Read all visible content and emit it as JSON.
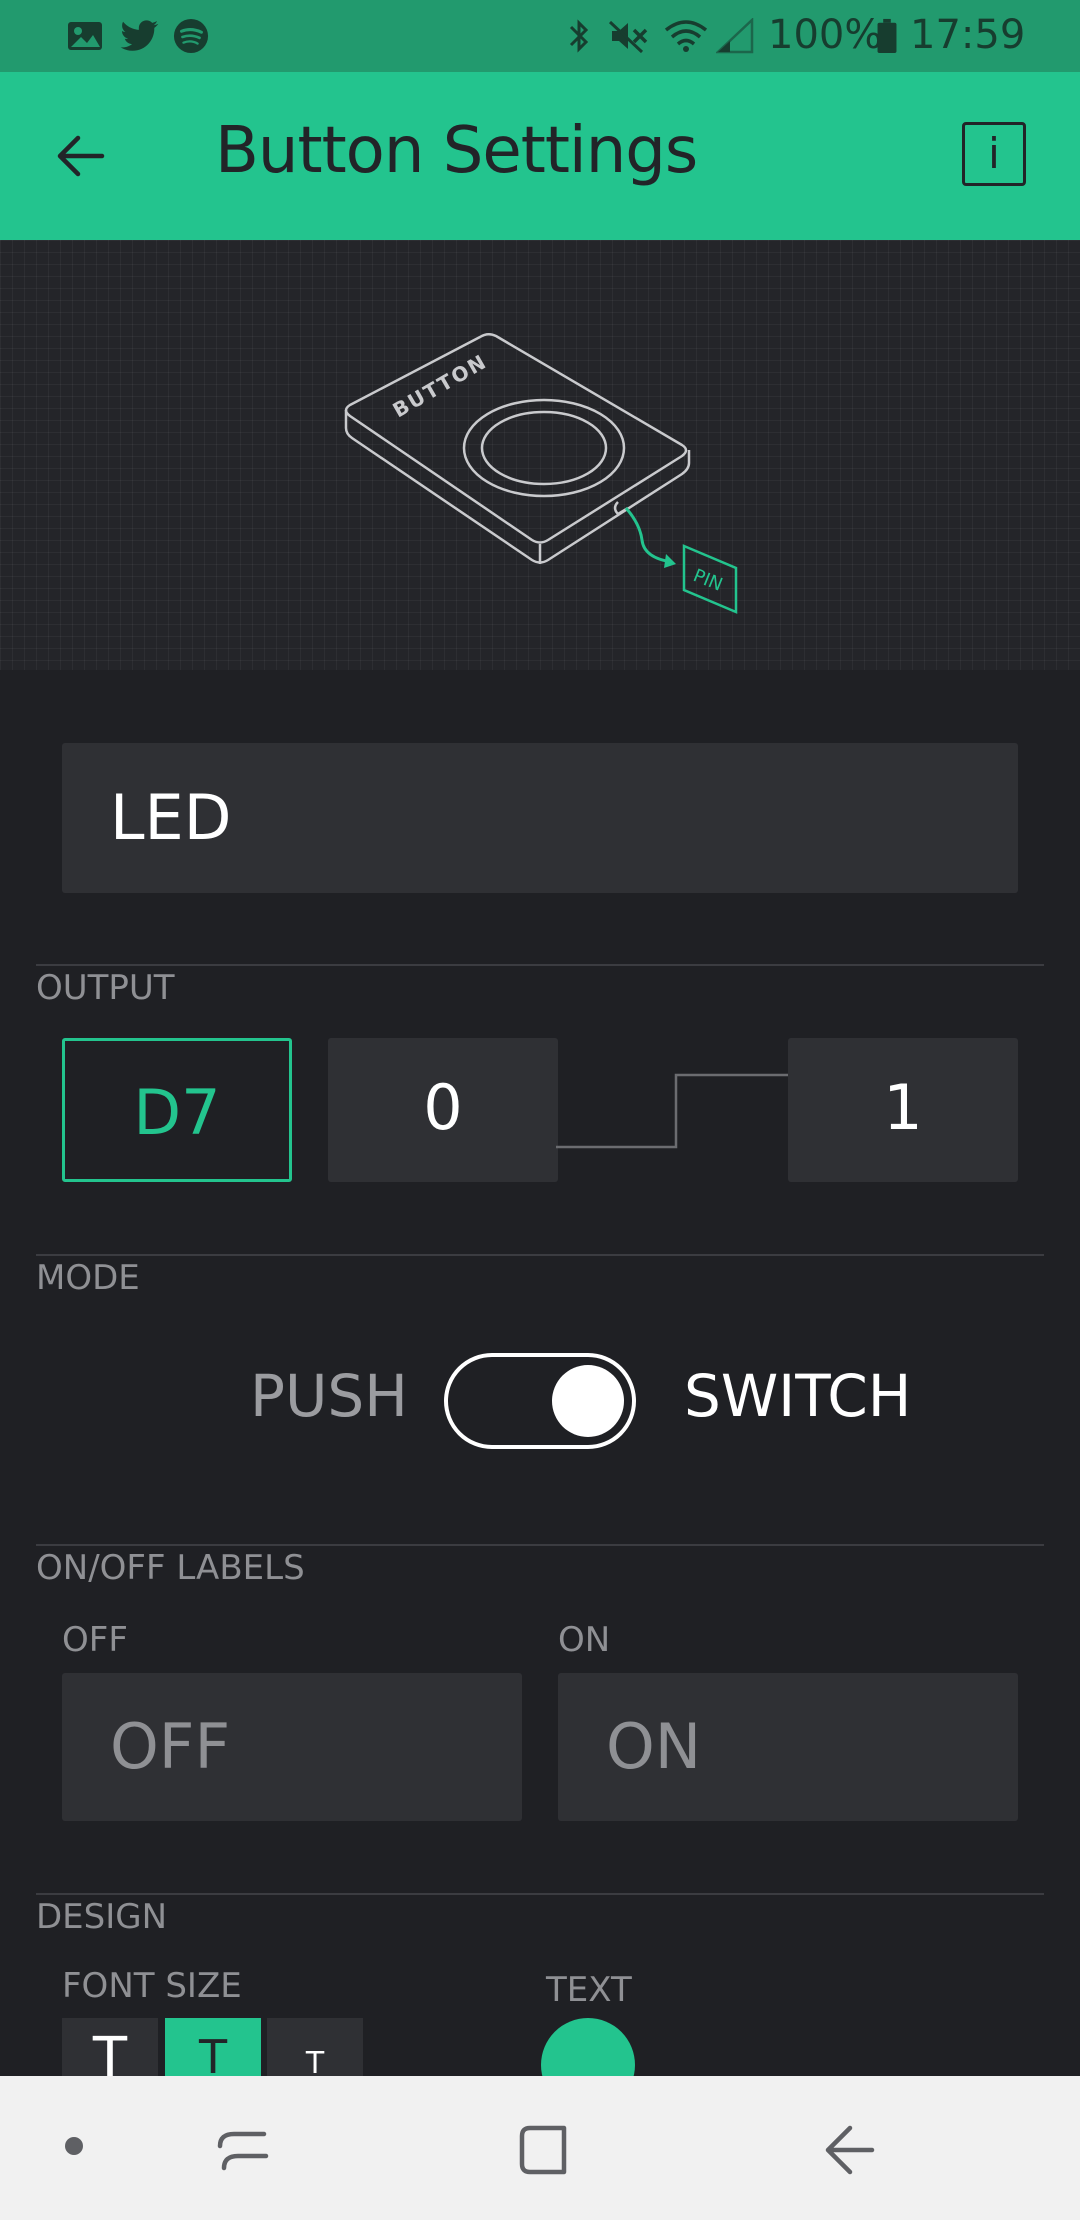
{
  "status_bar": {
    "battery_text": "100%",
    "time": "17:59",
    "icons": [
      "image-icon",
      "twitter-icon",
      "spotify-icon",
      "bluetooth-icon",
      "mute-icon",
      "wifi-icon",
      "signal-icon",
      "battery-icon"
    ]
  },
  "app_bar": {
    "title": "Button Settings",
    "info_label": "i"
  },
  "illustration": {
    "button_label": "BUTTON",
    "pin_label": "PIN"
  },
  "name_field": {
    "value": "LED"
  },
  "output": {
    "section_label": "OUTPUT",
    "pin": "D7",
    "low_value": "0",
    "high_value": "1"
  },
  "mode": {
    "section_label": "MODE",
    "left_label": "PUSH",
    "right_label": "SWITCH",
    "selected": "SWITCH"
  },
  "labels": {
    "section_label": "ON/OFF LABELS",
    "off_label": "OFF",
    "on_label": "ON",
    "off_placeholder": "OFF",
    "on_placeholder": "ON"
  },
  "design": {
    "section_label": "DESIGN",
    "font_size_label": "FONT SIZE",
    "text_label": "TEXT",
    "font_size_options": [
      "T",
      "T",
      "T"
    ],
    "selected_font_size": 1
  },
  "colors": {
    "accent": "#23c48e",
    "background": "#1f2024",
    "field": "#2f3034"
  }
}
